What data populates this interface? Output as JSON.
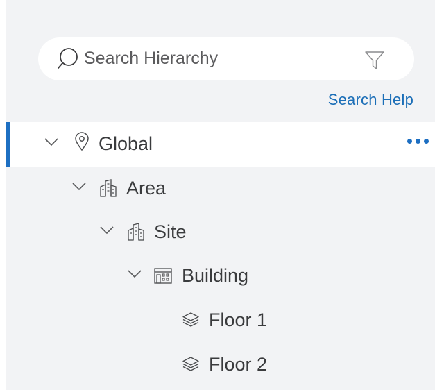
{
  "search": {
    "placeholder": "Search Hierarchy",
    "value": "",
    "help_label": "Search Help"
  },
  "tree": {
    "nodes": [
      {
        "label": "Global",
        "type": "global",
        "icon": "location-pin-icon",
        "expanded": true,
        "selected": true,
        "has_more_menu": true
      },
      {
        "label": "Area",
        "type": "area",
        "icon": "area-buildings-icon",
        "expanded": true
      },
      {
        "label": "Site",
        "type": "site",
        "icon": "site-buildings-icon",
        "expanded": true
      },
      {
        "label": "Building",
        "type": "building",
        "icon": "building-icon",
        "expanded": true
      },
      {
        "label": "Floor 1",
        "type": "floor",
        "icon": "floor-layers-icon"
      },
      {
        "label": "Floor 2",
        "type": "floor",
        "icon": "floor-layers-icon"
      }
    ]
  },
  "colors": {
    "accent": "#1d6fc2",
    "link": "#1b6eb7",
    "panel_bg": "#f2f3f5",
    "text": "#3a3b3d"
  }
}
